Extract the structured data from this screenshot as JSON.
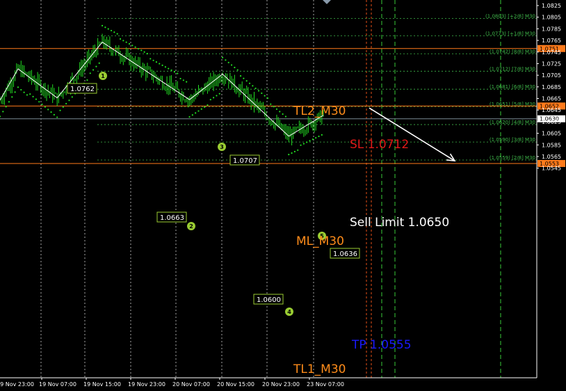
{
  "chart_data": {
    "type": "candlestick",
    "symbol_timeframe": "M30",
    "price_ticks": [
      "1.0825",
      "1.0805",
      "1.0785",
      "1.0765",
      "1.0745",
      "1.0725",
      "1.0705",
      "1.0685",
      "1.0665",
      "1.0645",
      "1.0625",
      "1.0605",
      "1.0585",
      "1.0565",
      "1.0545"
    ],
    "time_ticks": [
      "19 Nov 23:00",
      "19 Nov 07:00",
      "19 Nov 15:00",
      "19 Nov 23:00",
      "20 Nov 07:00",
      "20 Nov 15:00",
      "20 Nov 23:00",
      "23 Nov 07:00"
    ],
    "murrey_levels": [
      {
        "label": "(1.0803) [+2/8] M30",
        "price": 1.0803
      },
      {
        "label": "(1.0773) [+1/8] M30",
        "price": 1.0773
      },
      {
        "label": "(1.0742) [8/8] M30",
        "price": 1.0742
      },
      {
        "label": "(1.0712) [7/8] M30",
        "price": 1.0712
      },
      {
        "label": "(1.0681) [6/8] M30",
        "price": 1.0681
      },
      {
        "label": "(1.0651) [5/8] M30",
        "price": 1.0651
      },
      {
        "label": "(1.0620) [4/8] M30",
        "price": 1.062
      },
      {
        "label": "(1.0590) [3/8] M30",
        "price": 1.059
      },
      {
        "label": "(1.0559) [2/8] M30",
        "price": 1.0559
      }
    ],
    "horizontal_lines": [
      {
        "name": "TL2_M30",
        "price": 1.0751,
        "tag": "1.0751",
        "color": "#ff7a1a"
      },
      {
        "name": "ML_M30",
        "price": 1.0652,
        "tag": "1.0652",
        "color": "#ff7a1a"
      },
      {
        "name": "TL1_M30",
        "price": 1.0553,
        "tag": "1.0553",
        "color": "#ff7a1a"
      },
      {
        "name": "Bid",
        "price": 1.063,
        "tag": "1.0630",
        "color": "#7a8a94"
      }
    ],
    "text_labels": {
      "tl2": "TL2_M30",
      "ml": "ML_M30",
      "tl1": "TL1_M30",
      "sl": "SL 1.0712",
      "sell": "Sell Limit 1.0650",
      "tp": "TP 1.0555"
    },
    "zigzag": [
      {
        "t": 0,
        "p": 1.0662
      },
      {
        "t": 12,
        "p": 1.0716
      },
      {
        "t": 38,
        "p": 1.0666
      },
      {
        "t": 68,
        "p": 1.0762,
        "label": "1.0762",
        "wave": "1"
      },
      {
        "t": 126,
        "p": 1.0663,
        "label": "1.0663",
        "wave": "2"
      },
      {
        "t": 148,
        "p": 1.0707,
        "label": "1.0707",
        "wave": "3"
      },
      {
        "t": 192,
        "p": 1.06,
        "label": "1.0600",
        "wave": "4"
      },
      {
        "t": 215,
        "p": 1.0636,
        "label": "1.0636",
        "wave": "5"
      }
    ],
    "forecast_arrow": {
      "from_price": 1.0651,
      "to_price": 1.056
    },
    "colors": {
      "bull": "#22dd22",
      "bear": "#22dd22",
      "dots": "#22dd22",
      "zigzag": "#ffffff",
      "wave": "#9acd32",
      "murrey": "#3fb84a",
      "grid": "#ffffff"
    }
  }
}
